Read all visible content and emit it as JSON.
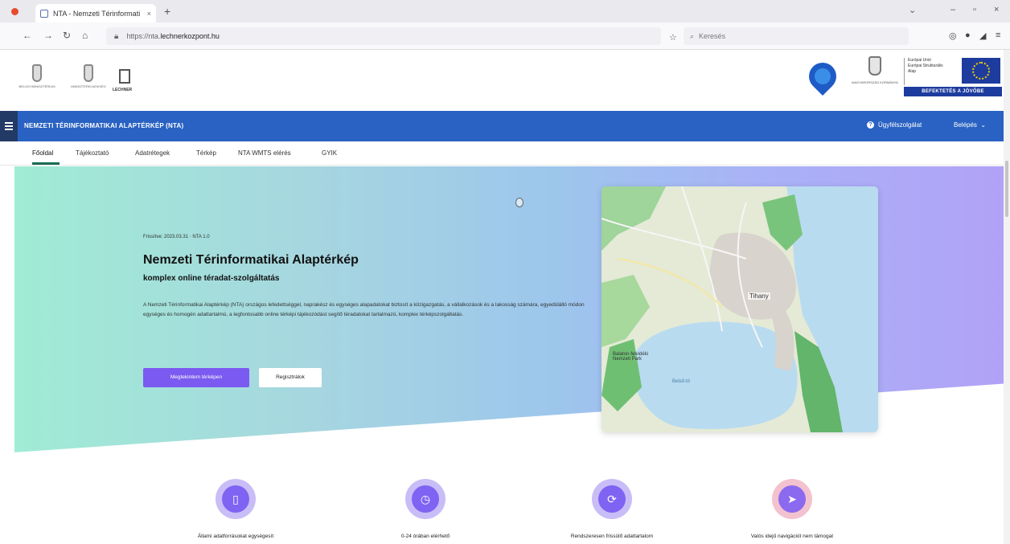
{
  "browser": {
    "tab_title": "NTA - Nemzeti Térinformati",
    "url_prefix": "https://nta.",
    "url_domain": "lechnerkozpont.hu",
    "search_placeholder": "Keresés"
  },
  "header": {
    "crest1_caption": "BELÜGYMINISZTÉRIUM",
    "crest2_caption": "MINISZTERELNÖKSÉG",
    "logo3_caption": "LECHNER",
    "hu_gov_caption": "MAGYARORSZÁG KORMÁNYA",
    "eu_text_lines": [
      "Európai Unió",
      "Európai Strukturális",
      "Alap"
    ],
    "eu_banner": "BEFEKTETÉS A JÖVŐBE"
  },
  "appbar": {
    "title": "NEMZETI TÉRINFORMATIKAI ALAPTÉRKÉP (NTA)",
    "help_label": "Ügyfélszolgálat",
    "login_label": "Belépés"
  },
  "tabs": [
    {
      "label": "Főoldal"
    },
    {
      "label": "Tájékoztató"
    },
    {
      "label": "Adatrétegek"
    },
    {
      "label": "Térkép"
    },
    {
      "label": "NTA WMTS elérés"
    },
    {
      "label": "GYIK"
    }
  ],
  "hero": {
    "updated": "Frissítve: 2023.03.31 · NTA 1.0",
    "title": "Nemzeti Térinformatikai Alaptérkép",
    "subtitle": "komplex online téradat-szolgáltatás",
    "description": "A Nemzeti Térinformatikai Alaptérkép (NTA) országos lefedettséggel, naprakész és egységes alapadatokat biztosít a közigazgatás, a vállalkozások és a lakosság számára, egyedülálló módon egységes és homogén adattartalmú, a legfontosabb online térképi tájékozódást segítő téradatokat tartalmazó, komplex térképszolgáltatás.",
    "primary_button": "Megtekintem térképen",
    "secondary_button": "Regisztrálok"
  },
  "map": {
    "city_label": "Tihany",
    "park_label": "Balaton-felvidéki Nemzeti Park",
    "lake_label": "Belső-tó"
  },
  "features": [
    {
      "label": "Állami adatforrásokat egységesít",
      "icon": "book-icon",
      "color": "#7f63f2"
    },
    {
      "label": "0-24 órában elérhető",
      "icon": "clock-icon",
      "color": "#7f63f2"
    },
    {
      "label": "Rendszeresen frissülő adattartalom",
      "icon": "refresh-icon",
      "color": "#7f63f2"
    },
    {
      "label": "Valós idejű navigációt nem támogat",
      "icon": "navigation-icon",
      "color": "#7f63f2"
    }
  ]
}
